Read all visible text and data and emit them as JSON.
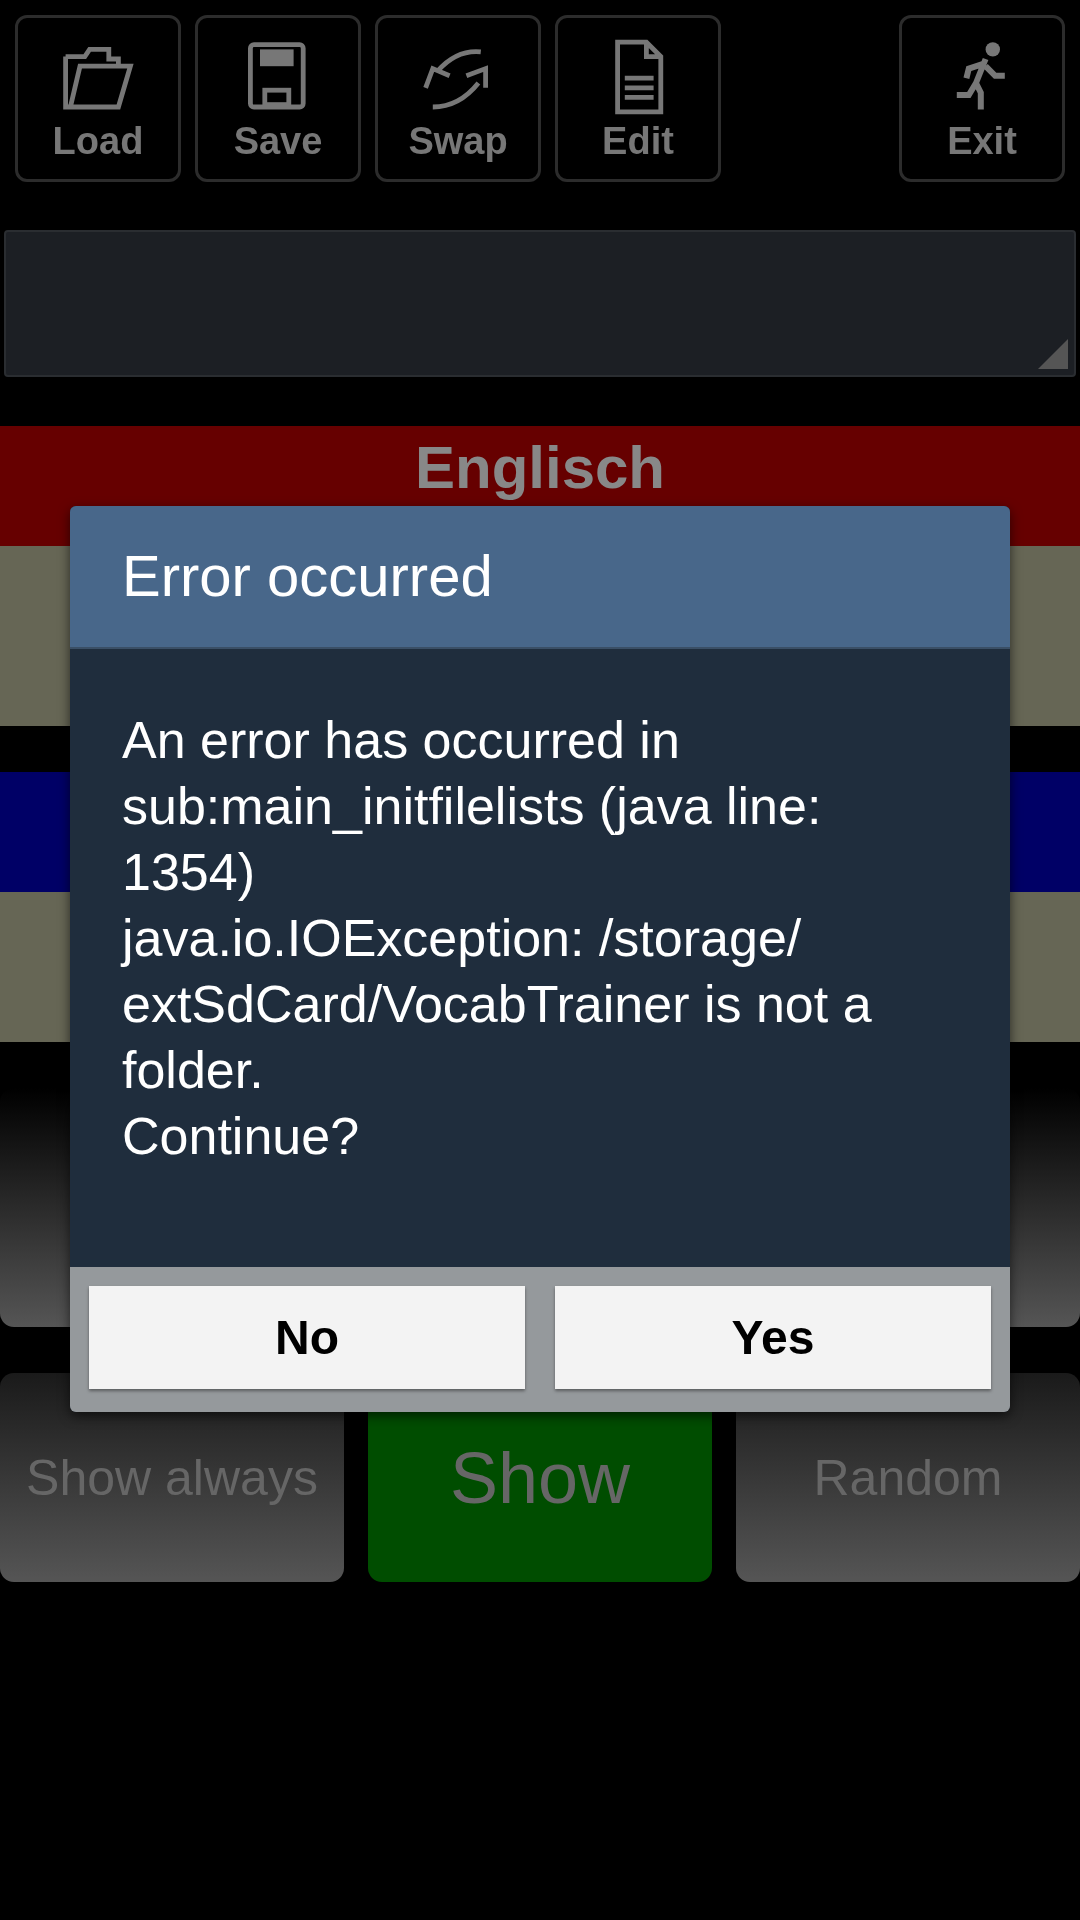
{
  "toolbar": [
    {
      "label": "Load",
      "kind": "folder"
    },
    {
      "label": "Save",
      "kind": "disk"
    },
    {
      "label": "Swap",
      "kind": "swap"
    },
    {
      "label": "Edit",
      "kind": "document"
    },
    {
      "label": "Exit",
      "kind": "runner"
    }
  ],
  "language_bars": [
    {
      "label": "Englisch",
      "color": "#660000"
    },
    {
      "color": "#000066"
    }
  ],
  "bottom_buttons": [
    {
      "label": "Show always",
      "kind": "plain"
    },
    {
      "label": "Show",
      "kind": "primary"
    },
    {
      "label": "Random",
      "kind": "plain"
    }
  ],
  "dialog": {
    "title": "Error occurred",
    "message": "An error has occurred in sub:main_initfilelists (java line: 1354)\njava.io.IOException: /storage/ extSdCard/VocabTrainer is not a folder.\nContinue?",
    "buttons": [
      "No",
      "Yes"
    ]
  }
}
